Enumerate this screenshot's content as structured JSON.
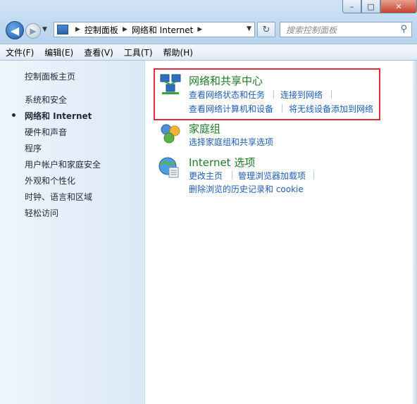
{
  "window": {
    "buttons": {
      "minimize": "–",
      "maximize": "□",
      "close": "✕"
    }
  },
  "nav": {
    "back_glyph": "◀",
    "forward_glyph": "▶",
    "breadcrumb": [
      "控制面板",
      "网络和 Internet"
    ],
    "search_placeholder": "搜索控制面板"
  },
  "menu": [
    "文件(F)",
    "编辑(E)",
    "查看(V)",
    "工具(T)",
    "帮助(H)"
  ],
  "sidebar": {
    "items": [
      "控制面板主页",
      "系统和安全",
      "网络和 Internet",
      "硬件和声音",
      "程序",
      "用户帐户和家庭安全",
      "外观和个性化",
      "时钟、语言和区域",
      "轻松访问"
    ],
    "active_index": 2
  },
  "categories": [
    {
      "title": "网络和共享中心",
      "icon": "network-icon",
      "links": [
        "查看网络状态和任务",
        "连接到网络",
        "查看网络计算机和设备",
        "将无线设备添加到网络"
      ]
    },
    {
      "title": "家庭组",
      "icon": "homegroup-icon",
      "links": [
        "选择家庭组和共享选项"
      ]
    },
    {
      "title": "Internet 选项",
      "icon": "internet-options-icon",
      "links": [
        "更改主页",
        "管理浏览器加载项",
        "删除浏览的历史记录和 cookie"
      ]
    }
  ],
  "colors": {
    "link": "#1e5fb3",
    "category_title": "#1f7a27",
    "highlight_border": "#e22b3b"
  }
}
